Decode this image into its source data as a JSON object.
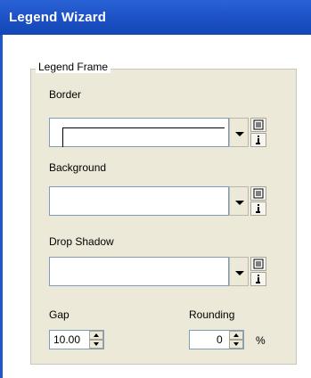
{
  "window": {
    "title": "Legend Wizard",
    "colors": {
      "titlebar": "#1e53c7",
      "face": "#ece9d8",
      "field_border": "#7f9db9"
    }
  },
  "legend_frame": {
    "group_label": "Legend Frame",
    "border": {
      "label": "Border",
      "value": "",
      "icons": [
        "chevron-down-icon",
        "list-icon",
        "info-icon"
      ]
    },
    "background": {
      "label": "Background",
      "value": "",
      "icons": [
        "chevron-down-icon",
        "list-icon",
        "info-icon"
      ]
    },
    "drop_shadow": {
      "label": "Drop Shadow",
      "value": "",
      "icons": [
        "chevron-down-icon",
        "list-icon",
        "info-icon"
      ]
    },
    "gap": {
      "label": "Gap",
      "value": "10.00"
    },
    "rounding": {
      "label": "Rounding",
      "value": "0",
      "unit": "%"
    }
  }
}
